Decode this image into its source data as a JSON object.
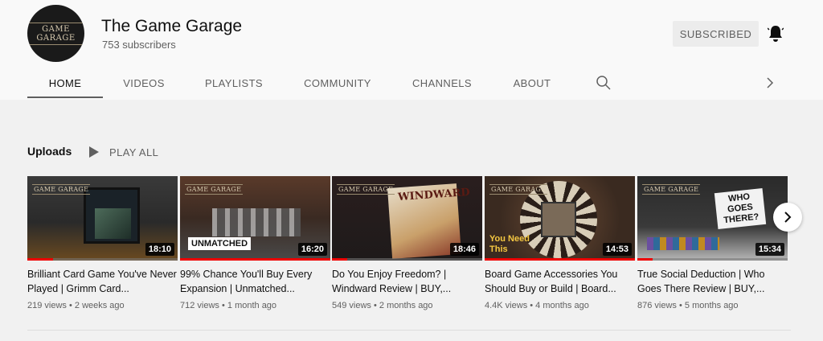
{
  "channel": {
    "avatar_text": "GAME GARAGE",
    "title": "The Game Garage",
    "subscribers": "753 subscribers",
    "subscribe_label": "SUBSCRIBED"
  },
  "tabs": [
    {
      "label": "HOME",
      "active": true
    },
    {
      "label": "VIDEOS"
    },
    {
      "label": "PLAYLISTS"
    },
    {
      "label": "COMMUNITY"
    },
    {
      "label": "CHANNELS"
    },
    {
      "label": "ABOUT"
    }
  ],
  "shelf": {
    "title": "Uploads",
    "play_all": "PLAY ALL"
  },
  "videos": [
    {
      "title": "Brilliant Card Game You've Never Played | Grimm Card...",
      "views": "219 views",
      "age": "2 weeks ago",
      "duration": "18:10",
      "progress": 0.17,
      "thumb_logo": "GAME GARAGE",
      "thumb_text": ""
    },
    {
      "title": "99% Chance You'll Buy Every Expansion | Unmatched...",
      "views": "712 views",
      "age": "1 month ago",
      "duration": "16:20",
      "progress": 1.0,
      "thumb_logo": "GAME GARAGE",
      "thumb_text": "UNMATCHED"
    },
    {
      "title": "Do You Enjoy Freedom? | Windward Review | BUY,...",
      "views": "549 views",
      "age": "2 months ago",
      "duration": "18:46",
      "progress": 0.1,
      "thumb_logo": "GAME GARAGE",
      "thumb_text": "WINDWARD"
    },
    {
      "title": "Board Game Accessories You Should Buy or Build | Board...",
      "views": "4.4K views",
      "age": "4 months ago",
      "duration": "14:53",
      "progress": 1.0,
      "thumb_logo": "GAME GARAGE",
      "thumb_text": "You Need This"
    },
    {
      "title": "True Social Deduction | Who Goes There Review | BUY,...",
      "views": "876 views",
      "age": "5 months ago",
      "duration": "15:34",
      "progress": 0.1,
      "thumb_logo": "GAME GARAGE",
      "thumb_text": "WHO GOES THERE?"
    }
  ],
  "icons": {
    "bell": "bell-icon",
    "search": "search-icon",
    "tabs_next": "chevron-right-icon",
    "play": "play-icon",
    "shelf_next": "chevron-right-icon"
  },
  "colors": {
    "progress": "#e00000",
    "subscribed_bg": "#ececec"
  }
}
